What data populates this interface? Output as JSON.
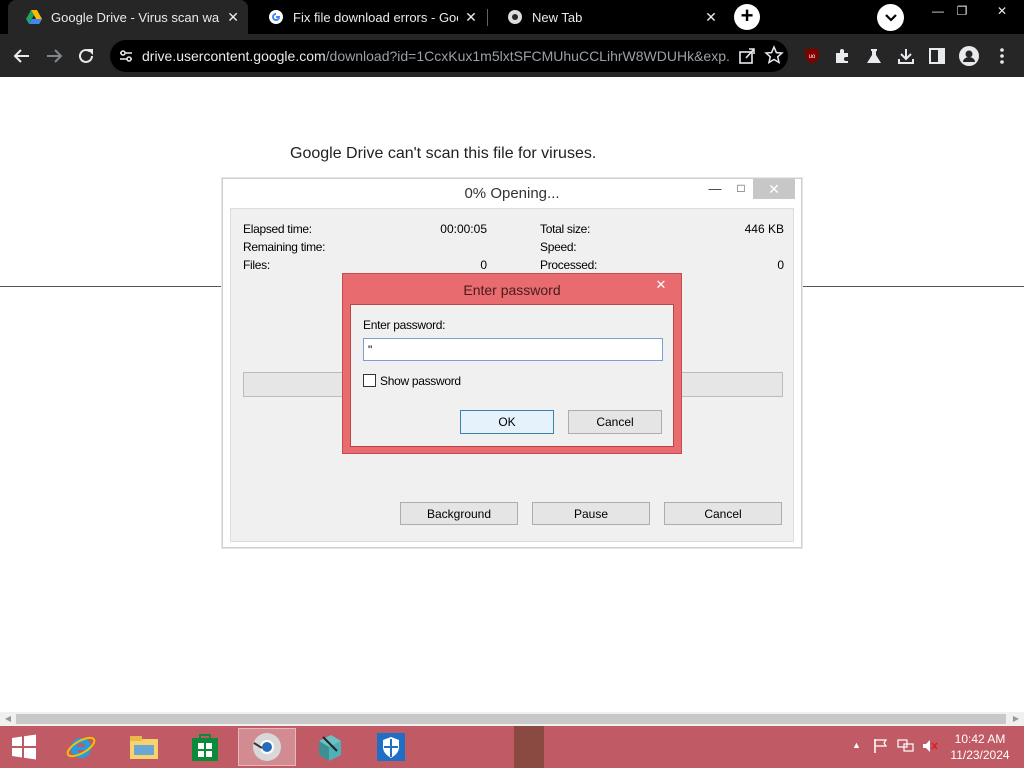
{
  "browser": {
    "tabs": [
      {
        "title": "Google Drive - Virus scan warning",
        "active": true,
        "icon": "google-drive-icon"
      },
      {
        "title": "Fix file download errors - Google",
        "active": false,
        "icon": "google-icon"
      },
      {
        "title": "New Tab",
        "active": false,
        "icon": "chrome-icon"
      }
    ],
    "newtab_symbol": "+",
    "window_controls": {
      "minimize": "—",
      "restore": "❐",
      "close": "✕"
    },
    "url_host": "drive.usercontent.google.com",
    "url_path": "/download?id=1CcxKux1m5lxtSFCMUhuCCLihrW8WDUHk&exp..."
  },
  "page": {
    "warning_text": "Google Drive can't scan this file for viruses."
  },
  "progress_dialog": {
    "title": "0% Opening...",
    "controls": {
      "minimize": "—",
      "maximize": "□",
      "close": "✕"
    },
    "elapsed_label": "Elapsed time:",
    "elapsed_value": "00:00:05",
    "remaining_label": "Remaining time:",
    "remaining_value": "",
    "files_label": "Files:",
    "files_value": "0",
    "total_size_label": "Total size:",
    "total_size_value": "446 KB",
    "speed_label": "Speed:",
    "speed_value": "",
    "processed_label": "Processed:",
    "processed_value": "0",
    "progress": 0,
    "background_button": "Background",
    "pause_button": "Pause",
    "cancel_button": "Cancel"
  },
  "password_dialog": {
    "title": "Enter password",
    "close": "✕",
    "prompt_label": "Enter password:",
    "password_value": "\"",
    "show_password_label": "Show password",
    "show_password_checked": false,
    "ok_button": "OK",
    "cancel_button": "Cancel"
  },
  "taskbar": {
    "apps": [
      "start-icon",
      "internet-explorer-icon",
      "file-explorer-icon",
      "store-icon",
      "chrome-icon",
      "archive-app-icon",
      "defender-icon"
    ],
    "tray_arrow": "▲",
    "time": "10:42 AM",
    "date": "11/23/2024"
  },
  "colors": {
    "taskbar": "#c05a64",
    "password_dialog_frame": "#e86b6f",
    "chrome_dark": "#262626"
  }
}
